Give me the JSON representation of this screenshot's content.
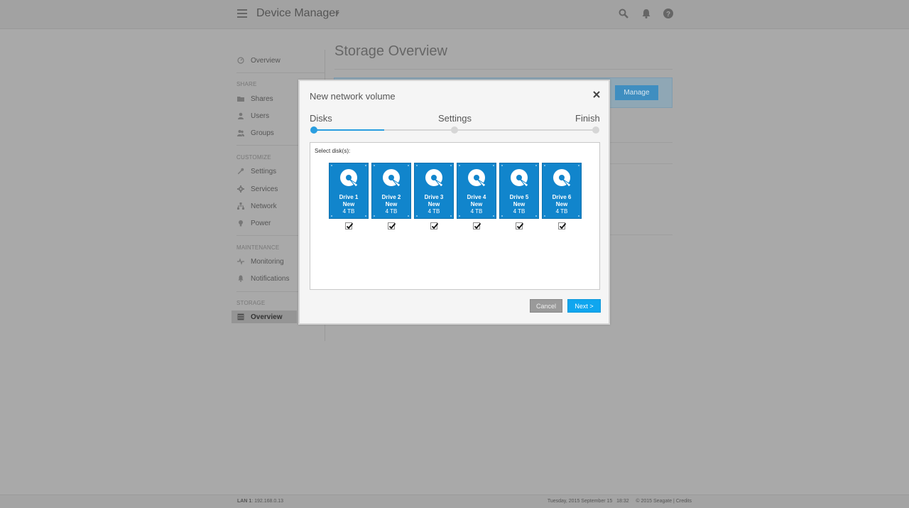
{
  "header": {
    "title": "Device Manager",
    "icons": [
      "menu-icon",
      "search-icon",
      "bell-icon",
      "help-icon"
    ]
  },
  "sidebar": {
    "overview_top": "Overview",
    "sections": {
      "share": "SHARE",
      "customize": "CUSTOMIZE",
      "maintenance": "MAINTENANCE",
      "storage": "STORAGE"
    },
    "items": {
      "shares": "Shares",
      "users": "Users",
      "groups": "Groups",
      "settings": "Settings",
      "services": "Services",
      "network": "Network",
      "power": "Power",
      "monitoring": "Monitoring",
      "notifications": "Notifications",
      "storage_overview": "Overview"
    }
  },
  "main": {
    "page_title": "Storage Overview",
    "manage_label": "Manage"
  },
  "modal": {
    "title": "New network volume",
    "steps": [
      "Disks",
      "Settings",
      "Finish"
    ],
    "current_step": 1,
    "progress": 0.25,
    "prompt": "Select disk(s):",
    "drives": [
      {
        "name": "Drive 1",
        "status": "New",
        "size": "4 TB",
        "checked": true
      },
      {
        "name": "Drive 2",
        "status": "New",
        "size": "4 TB",
        "checked": true
      },
      {
        "name": "Drive 3",
        "status": "New",
        "size": "4 TB",
        "checked": true
      },
      {
        "name": "Drive 4",
        "status": "New",
        "size": "4 TB",
        "checked": true
      },
      {
        "name": "Drive 5",
        "status": "New",
        "size": "4 TB",
        "checked": true
      },
      {
        "name": "Drive 6",
        "status": "New",
        "size": "4 TB",
        "checked": true
      }
    ],
    "cancel_label": "Cancel",
    "next_label": "Next >"
  },
  "footer": {
    "lan_label": "LAN 1",
    "lan_ip": ": 192.168.0.13",
    "datetime": "Tuesday, 2015 September 15   18:32",
    "copyright": "© 2015 Seagate |",
    "credits": "Credits"
  },
  "colors": {
    "accent": "#2a9ee0",
    "drive_blue": "#1185cc",
    "next_button": "#0fa6ef",
    "overlay_gray": "#a9a9a9"
  }
}
